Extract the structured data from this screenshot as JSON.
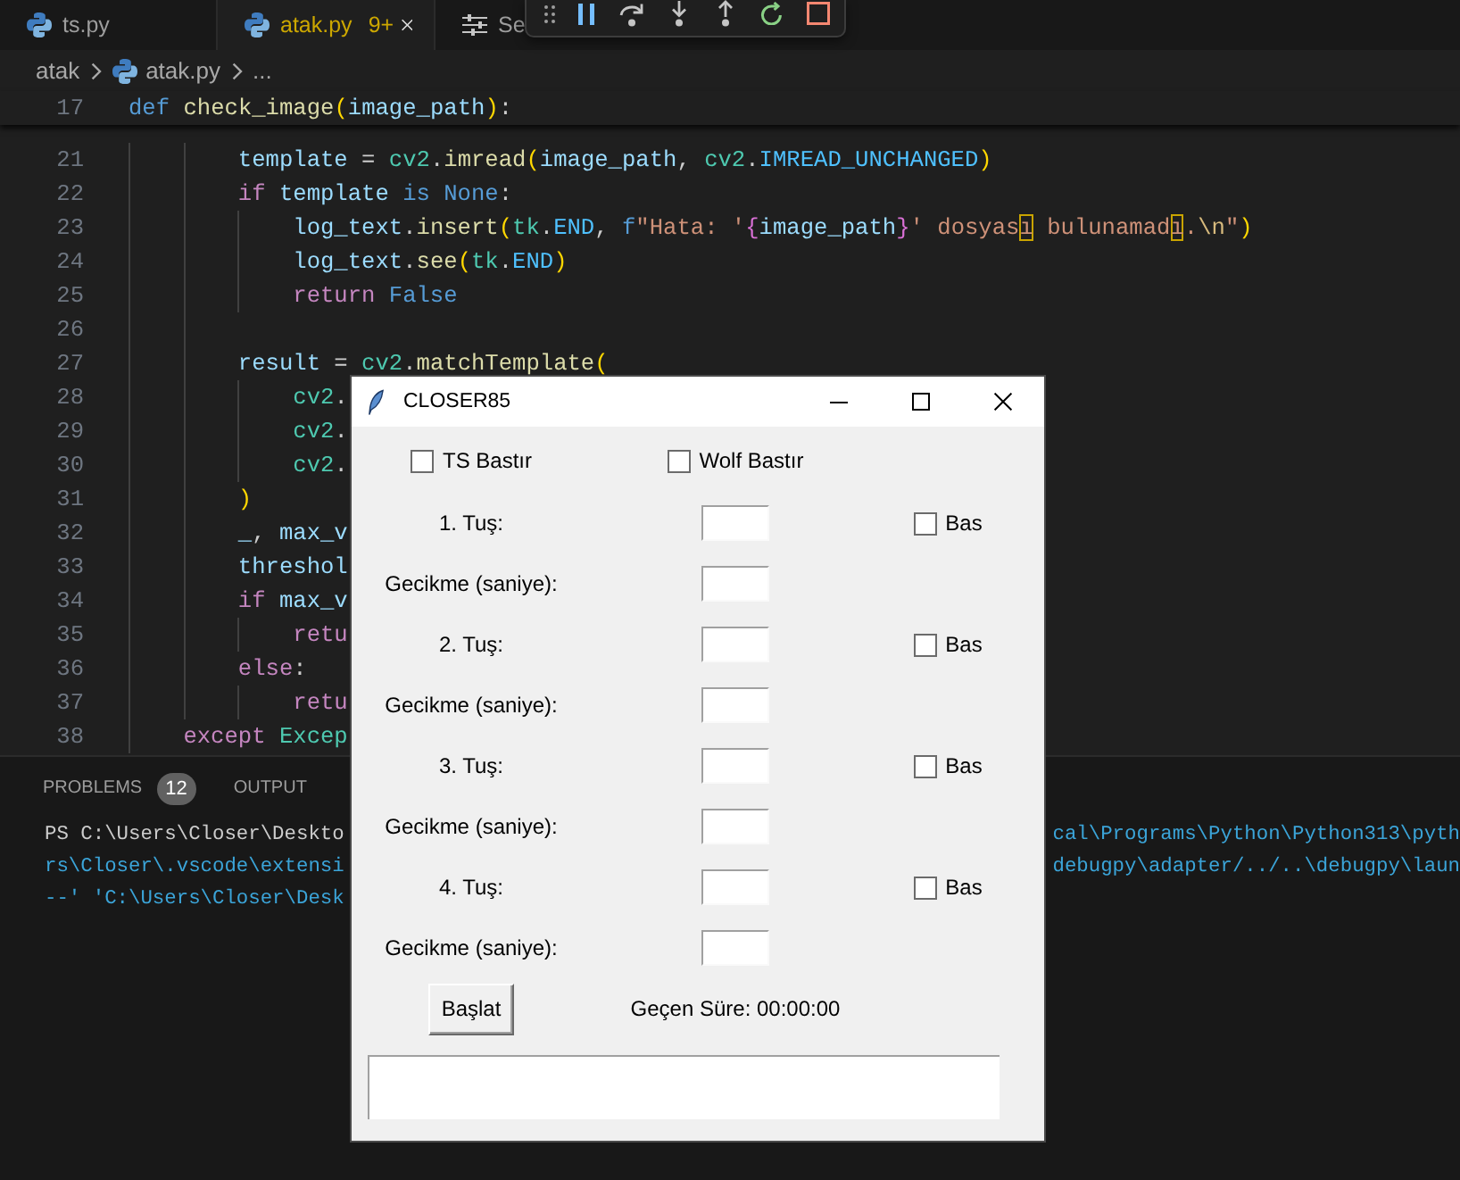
{
  "editor_tabs": [
    {
      "kind": "file",
      "label": "ts.py",
      "selected": false,
      "warning": false
    },
    {
      "kind": "file",
      "label": "atak.py",
      "badge": "9+",
      "selected": true,
      "warning": true
    },
    {
      "kind": "settings",
      "label": "Se",
      "selected": false,
      "warning": false
    }
  ],
  "breadcrumbs": [
    {
      "kind": "folder",
      "label": "atak"
    },
    {
      "kind": "file",
      "label": "atak.py"
    },
    {
      "kind": "more",
      "label": "..."
    }
  ],
  "sticky_line": {
    "number": "17",
    "tokens": [
      {
        "kind": "storage",
        "text": "def"
      },
      {
        "kind": "function",
        "text": " check_image"
      },
      {
        "kind": "bracket1",
        "text": "("
      },
      {
        "kind": "variable",
        "text": "image_path"
      },
      {
        "kind": "bracket1",
        "text": ")"
      },
      {
        "kind": "plain",
        "text": ":"
      }
    ]
  },
  "code_lines": [
    {
      "number": "21",
      "tokens": [
        {
          "kind": "variable",
          "text": "        template"
        },
        {
          "kind": "plain",
          "text": " = "
        },
        {
          "kind": "class",
          "text": "cv2"
        },
        {
          "kind": "plain",
          "text": "."
        },
        {
          "kind": "function",
          "text": "imread"
        },
        {
          "kind": "bracket1",
          "text": "("
        },
        {
          "kind": "variable",
          "text": "image_path"
        },
        {
          "kind": "plain",
          "text": ", "
        },
        {
          "kind": "class",
          "text": "cv2"
        },
        {
          "kind": "plain",
          "text": "."
        },
        {
          "kind": "constant",
          "text": "IMREAD_UNCHANGED"
        },
        {
          "kind": "bracket1",
          "text": ")"
        }
      ]
    },
    {
      "number": "22",
      "tokens": [
        {
          "kind": "keyword",
          "text": "        if"
        },
        {
          "kind": "variable",
          "text": " template"
        },
        {
          "kind": "storage",
          "text": " is None"
        },
        {
          "kind": "plain",
          "text": ":"
        }
      ]
    },
    {
      "number": "23",
      "tokens": [
        {
          "kind": "variable",
          "text": "            log_text"
        },
        {
          "kind": "plain",
          "text": "."
        },
        {
          "kind": "function",
          "text": "insert"
        },
        {
          "kind": "bracket1",
          "text": "("
        },
        {
          "kind": "class",
          "text": "tk"
        },
        {
          "kind": "plain",
          "text": "."
        },
        {
          "kind": "constant",
          "text": "END"
        },
        {
          "kind": "plain",
          "text": ", "
        },
        {
          "kind": "storage",
          "text": "f"
        },
        {
          "kind": "string",
          "text": "\"Hata: '"
        },
        {
          "kind": "bracket2",
          "text": "{"
        },
        {
          "kind": "variable",
          "text": "image_path"
        },
        {
          "kind": "bracket2",
          "text": "}"
        },
        {
          "kind": "string",
          "text": "' dosyas"
        },
        {
          "kind": "ambiguous",
          "text": "ı"
        },
        {
          "kind": "string",
          "text": " bulunamad"
        },
        {
          "kind": "ambiguous",
          "text": "ı"
        },
        {
          "kind": "string",
          "text": "."
        },
        {
          "kind": "escape",
          "text": "\\n"
        },
        {
          "kind": "string",
          "text": "\""
        },
        {
          "kind": "bracket1",
          "text": ")"
        }
      ]
    },
    {
      "number": "24",
      "tokens": [
        {
          "kind": "variable",
          "text": "            log_text"
        },
        {
          "kind": "plain",
          "text": "."
        },
        {
          "kind": "function",
          "text": "see"
        },
        {
          "kind": "bracket1",
          "text": "("
        },
        {
          "kind": "class",
          "text": "tk"
        },
        {
          "kind": "plain",
          "text": "."
        },
        {
          "kind": "constant",
          "text": "END"
        },
        {
          "kind": "bracket1",
          "text": ")"
        }
      ]
    },
    {
      "number": "25",
      "tokens": [
        {
          "kind": "keyword",
          "text": "            return"
        },
        {
          "kind": "storage",
          "text": " False"
        }
      ]
    },
    {
      "number": "26"
    },
    {
      "number": "27",
      "tokens": [
        {
          "kind": "variable",
          "text": "        result"
        },
        {
          "kind": "plain",
          "text": " = "
        },
        {
          "kind": "class",
          "text": "cv2"
        },
        {
          "kind": "plain",
          "text": "."
        },
        {
          "kind": "function",
          "text": "matchTemplate"
        },
        {
          "kind": "bracket1",
          "text": "("
        }
      ]
    },
    {
      "number": "28",
      "tokens": [
        {
          "kind": "class",
          "text": "            cv2"
        },
        {
          "kind": "plain",
          "text": "."
        }
      ]
    },
    {
      "number": "29",
      "tokens": [
        {
          "kind": "class",
          "text": "            cv2"
        },
        {
          "kind": "plain",
          "text": "."
        }
      ]
    },
    {
      "number": "30",
      "tokens": [
        {
          "kind": "class",
          "text": "            cv2"
        },
        {
          "kind": "plain",
          "text": "."
        }
      ]
    },
    {
      "number": "31",
      "tokens": [
        {
          "kind": "bracket1",
          "text": "        )"
        }
      ]
    },
    {
      "number": "32",
      "tokens": [
        {
          "kind": "variable",
          "text": "        _"
        },
        {
          "kind": "plain",
          "text": ", "
        },
        {
          "kind": "variable",
          "text": "max_v"
        }
      ]
    },
    {
      "number": "33",
      "tokens": [
        {
          "kind": "variable",
          "text": "        threshol"
        }
      ]
    },
    {
      "number": "34",
      "tokens": [
        {
          "kind": "keyword",
          "text": "        if"
        },
        {
          "kind": "variable",
          "text": " max_v"
        }
      ]
    },
    {
      "number": "35",
      "tokens": [
        {
          "kind": "keyword",
          "text": "            retu"
        }
      ]
    },
    {
      "number": "36",
      "tokens": [
        {
          "kind": "keyword",
          "text": "        else"
        },
        {
          "kind": "plain",
          "text": ":"
        }
      ]
    },
    {
      "number": "37",
      "tokens": [
        {
          "kind": "keyword",
          "text": "            retu"
        }
      ]
    },
    {
      "number": "38",
      "tokens": [
        {
          "kind": "keyword",
          "text": "    except"
        },
        {
          "kind": "class",
          "text": " Excep"
        }
      ]
    }
  ],
  "panel": {
    "tabs": [
      {
        "label": "PROBLEMS",
        "badge": "12",
        "selected": false
      },
      {
        "label": "OUTPUT",
        "selected": false
      }
    ],
    "terminal_lines": [
      {
        "segments": [
          {
            "kind": "prompt",
            "text": "PS C:\\Users\\Closer\\Deskto"
          },
          {
            "kind": "command",
            "text": "cal\\Programs\\Python\\Python313\\pyth"
          }
        ]
      },
      {
        "segments": [
          {
            "kind": "command",
            "text": "rs\\Closer\\.vscode\\extensi"
          },
          {
            "kind": "command",
            "text": "debugpy\\adapter/../..\\debugpy\\laun"
          }
        ]
      },
      {
        "segments": [
          {
            "kind": "command",
            "text": "--' 'C:\\Users\\Closer\\Desk"
          }
        ]
      }
    ]
  },
  "dialog": {
    "title": "CLOSER85",
    "top_checkboxes": [
      {
        "label": "TS Bastır",
        "checked": false
      },
      {
        "label": "Wolf Bastır",
        "checked": false
      }
    ],
    "rows": [
      {
        "label": "1. Tuş:",
        "checkbox": {
          "label": "Bas",
          "checked": false
        }
      },
      {
        "label": "Gecikme (saniye):"
      },
      {
        "label": "2. Tuş:",
        "checkbox": {
          "label": "Bas",
          "checked": false
        }
      },
      {
        "label": "Gecikme (saniye):"
      },
      {
        "label": "3. Tuş:",
        "checkbox": {
          "label": "Bas",
          "checked": false
        }
      },
      {
        "label": "Gecikme (saniye):"
      },
      {
        "label": "4. Tuş:",
        "checkbox": {
          "label": "Bas",
          "checked": false
        }
      },
      {
        "label": "Gecikme (saniye):"
      }
    ],
    "start_button": "Başlat",
    "elapsed": "Geçen Süre: 00:00:00"
  }
}
